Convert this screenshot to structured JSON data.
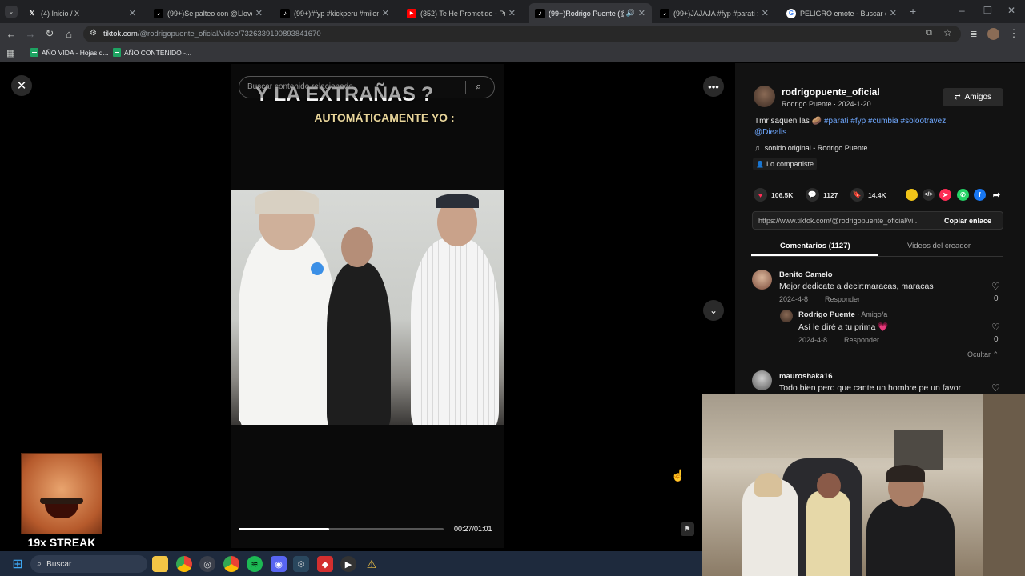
{
  "browser": {
    "tabs": [
      {
        "title": "(4) Inicio / X",
        "icon": "x-logo-icon",
        "active": false
      },
      {
        "title": "(99+)Se palteo con @Llovergar",
        "icon": "tiktok-icon",
        "active": false
      },
      {
        "title": "(99+)#fyp #kickperu #milenka",
        "icon": "tiktok-icon",
        "active": false
      },
      {
        "title": "(352) Te He Prometido - Puro M",
        "icon": "youtube-icon",
        "active": false
      },
      {
        "title": "(99+)Rodrigo Puente (@ro",
        "icon": "tiktok-icon",
        "active": true
      },
      {
        "title": "(99+)JAJAJA #fyp #parati #Die",
        "icon": "tiktok-icon",
        "active": false
      },
      {
        "title": "PELIGRO emote - Buscar con G",
        "icon": "google-icon",
        "active": false
      }
    ],
    "url_host": "tiktok.com",
    "url_path": "/@rodrigopuente_oficial/video/7326339190893841670",
    "bookmarks": [
      "AÑO VIDA - Hojas d...",
      "AÑO CONTENIDO -..."
    ]
  },
  "video": {
    "search_placeholder": "Buscar contenido relacionado",
    "overlay_line1": "Y LA EXTRAÑAS ?",
    "overlay_line2": "AUTOMÁTICAMENTE YO :",
    "time": "00:27/01:01",
    "progress": 0.44
  },
  "creator": {
    "handle": "rodrigopuente_oficial",
    "name_date": "Rodrigo Puente · 2024-1-20",
    "friends_label": "Amigos",
    "caption_text": "Tmr saquen las 🥔 ",
    "caption_tags": "#parati #fyp #cumbia #solootravez",
    "caption_tags2": "@Diealis",
    "sound": "sonido original - Rodrigo Puente",
    "shared": "Lo compartiste"
  },
  "stats": {
    "likes": "106.5K",
    "comments": "1127",
    "saves": "14.4K"
  },
  "link": {
    "url": "https://www.tiktok.com/@rodrigopuente_oficial/vi...",
    "copy_label": "Copiar enlace"
  },
  "tabs": {
    "comments": "Comentarios (1127)",
    "creator_videos": "Videos del creador"
  },
  "comments": [
    {
      "user": "Benito Camelo",
      "text": "Mejor dedicate a decir:maracas, maracas",
      "date": "2024-4-8",
      "reply": "Responder",
      "likes": "0"
    },
    {
      "user": "Rodrigo Puente",
      "badge": " · Amigo/a",
      "text": "Así le diré a tu prima 💗",
      "date": "2024-4-8",
      "reply": "Responder",
      "likes": "0"
    },
    {
      "user": "mauroshaka16",
      "text": "Todo bien pero que cante un hombre pe un favor"
    }
  ],
  "hide_label": "Ocultar",
  "taskbar": {
    "search": "Buscar"
  },
  "streak_label": "19x STREAK"
}
